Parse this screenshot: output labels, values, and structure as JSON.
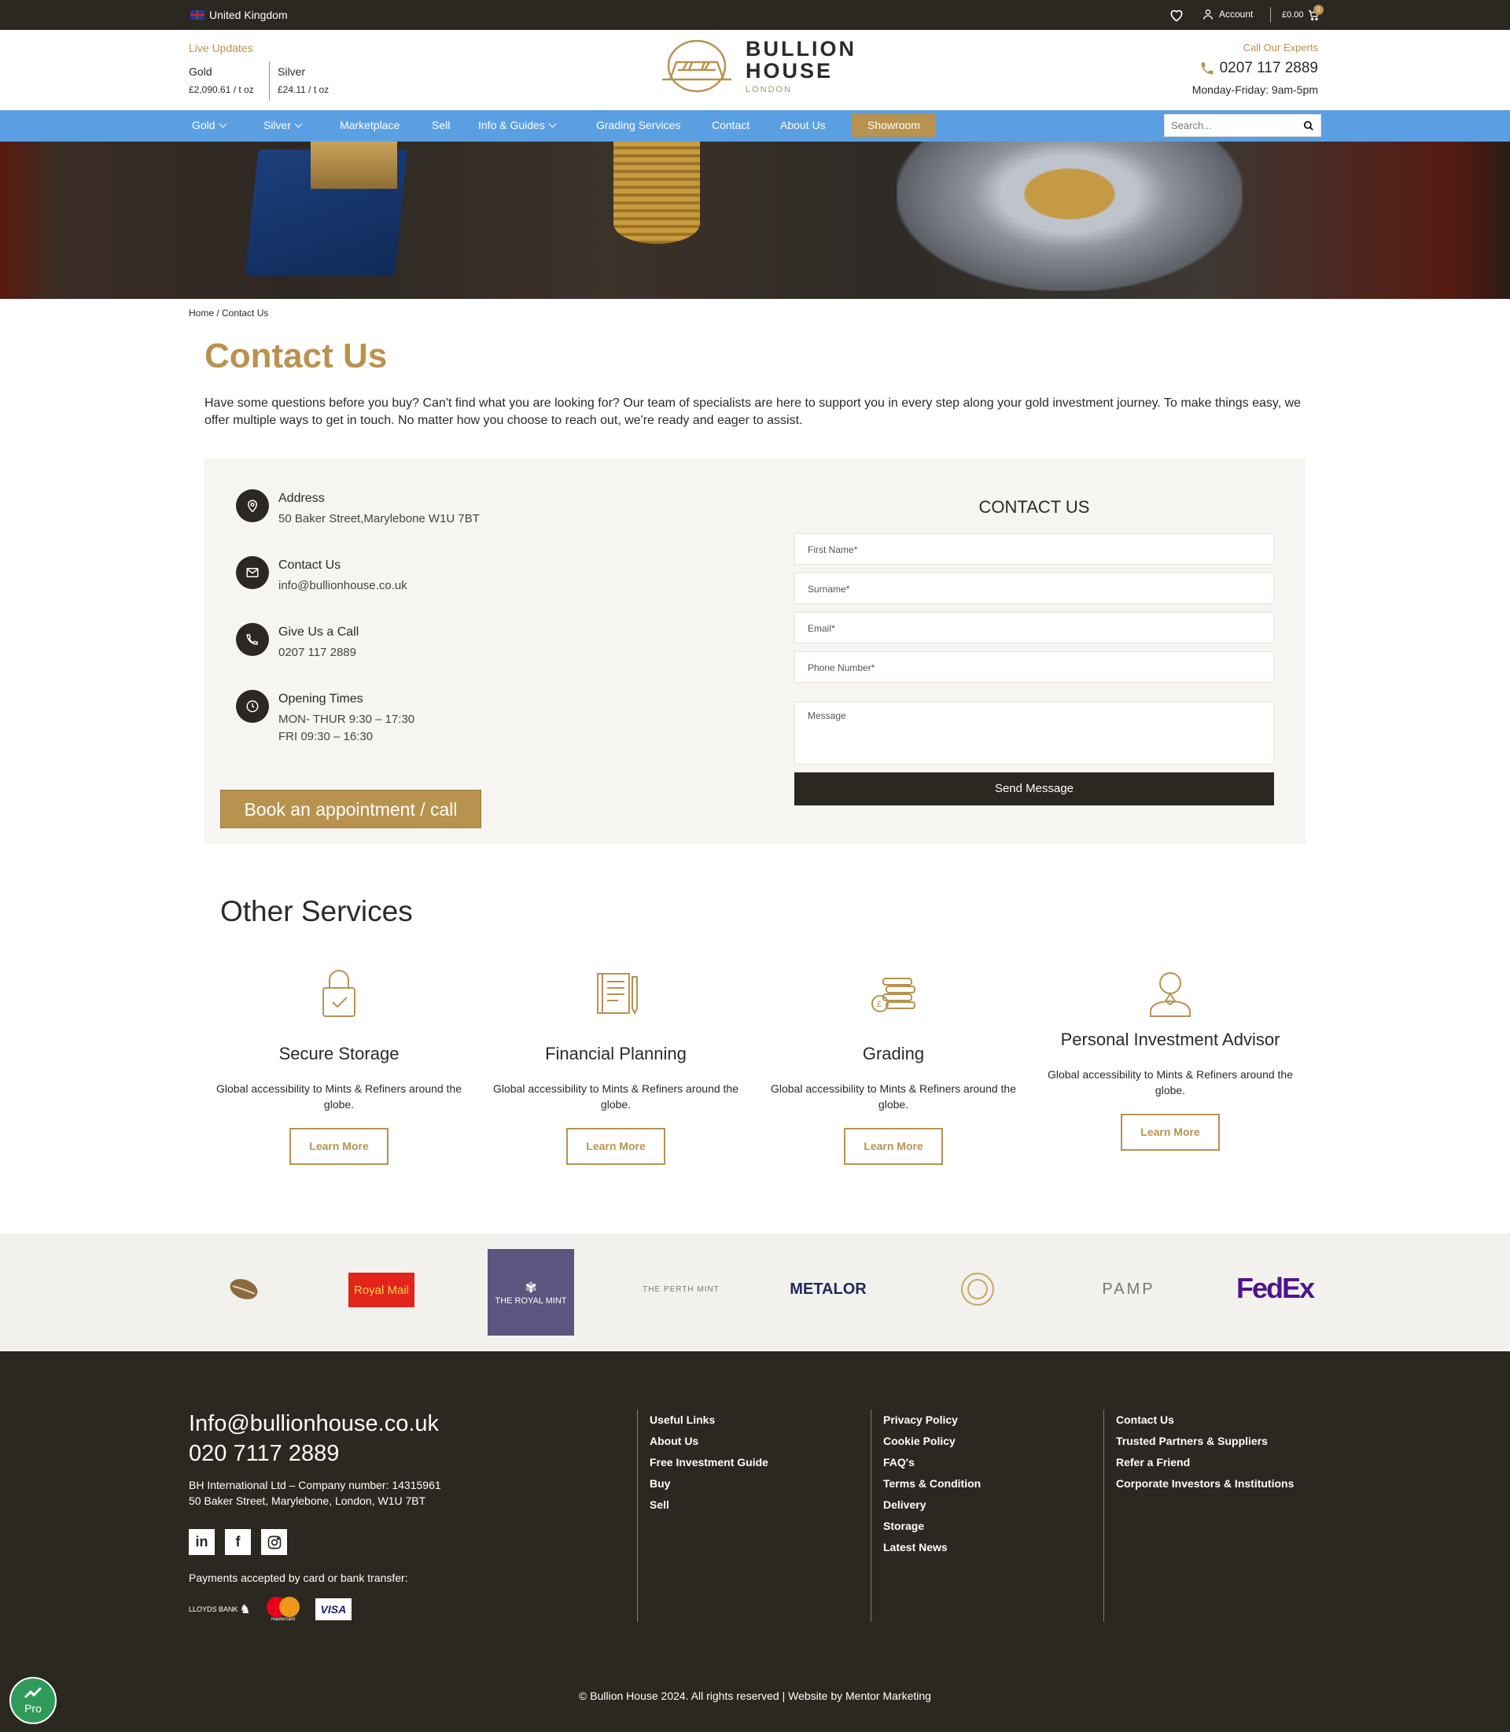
{
  "topbar": {
    "country": "United Kingdom",
    "account": "Account",
    "cart_total": "£0.00",
    "cart_count": "0"
  },
  "header": {
    "live_title": "Live Updates",
    "gold_label": "Gold",
    "gold_price": "£2,090.61 / t oz",
    "silver_label": "Silver",
    "silver_price": "£24.11 / t oz",
    "logo_line1": "BULLION",
    "logo_line2": "HOUSE",
    "logo_line3": "LONDON",
    "experts": "Call Our Experts",
    "phone": "0207 117 2889",
    "hours": "Monday-Friday: 9am-5pm"
  },
  "nav": {
    "items": [
      "Gold",
      "Silver",
      "Marketplace",
      "Sell",
      "Info & Guides",
      "Grading Services",
      "Contact",
      "About Us"
    ],
    "showroom": "Showroom",
    "search_placeholder": "Search..."
  },
  "breadcrumb": "Home / Contact Us",
  "page": {
    "title": "Contact Us",
    "intro": "Have some questions before you buy? Can't find what you are looking for? Our team of specialists are here to support you in every step along your gold investment journey. To make things easy, we offer multiple ways to get in touch. No matter how you choose to reach out, we're ready and eager to assist."
  },
  "contact": {
    "address_title": "Address",
    "address": "50 Baker Street,Marylebone W1U 7BT",
    "email_title": "Contact Us",
    "email": "info@bullionhouse.co.uk",
    "call_title": "Give Us a Call",
    "call": "0207 117 2889",
    "times_title": "Opening Times",
    "times_1": "MON- THUR 9:30 – 17:30",
    "times_2": "FRI 09:30 – 16:30",
    "book": "Book an appointment / call",
    "form_title": "CONTACT US",
    "first_name": "First Name*",
    "surname": "Surname*",
    "email_field": "Email*",
    "phone_field": "Phone Number*",
    "message": "Message",
    "send": "Send Message"
  },
  "services": {
    "title": "Other Services",
    "items": [
      {
        "name": "Secure Storage",
        "desc": "Global accessibility to Mints & Refiners around the globe.",
        "cta": "Learn More"
      },
      {
        "name": "Financial Planning",
        "desc": "Global accessibility to Mints & Refiners around the globe.",
        "cta": "Learn More"
      },
      {
        "name": "Grading",
        "desc": "Global accessibility to Mints & Refiners around the globe.",
        "cta": "Learn More"
      },
      {
        "name": "Personal Investment Advisor",
        "desc": "Global accessibility to Mints & Refiners around the globe.",
        "cta": "Learn More"
      }
    ]
  },
  "partners": [
    "Royal Mail",
    "THE ROYAL MINT",
    "THE PERTH MINT",
    "METALOR",
    "PAMP",
    "FedEx"
  ],
  "footer": {
    "email": "Info@bullionhouse.co.uk",
    "phone": "020 7117 2889",
    "company": "BH International Ltd – Company number: 14315961",
    "address": "50 Baker Street, Marylebone, London, W1U 7BT",
    "payments": "Payments accepted by card or bank transfer:",
    "pay_brands": [
      "LLOYDS BANK",
      "mastercard",
      "VISA"
    ],
    "col1": [
      "Useful Links",
      "About Us",
      "Free Investment Guide",
      "Buy",
      "Sell"
    ],
    "col2": [
      "Privacy Policy",
      "Cookie Policy",
      "FAQ's",
      "Terms & Condition",
      "Delivery",
      "Storage",
      "Latest News"
    ],
    "col3": [
      "Contact Us",
      "Trusted Partners & Suppliers",
      "Refer a Friend",
      "Corporate Investors & Institutions"
    ],
    "copyright": "© Bullion House 2024. All rights reserved | Website by Mentor Marketing"
  },
  "widget": {
    "label": "Pro"
  },
  "colors": {
    "accent": "#b8924f",
    "nav": "#5b9fe3",
    "dark": "#2b2721"
  }
}
